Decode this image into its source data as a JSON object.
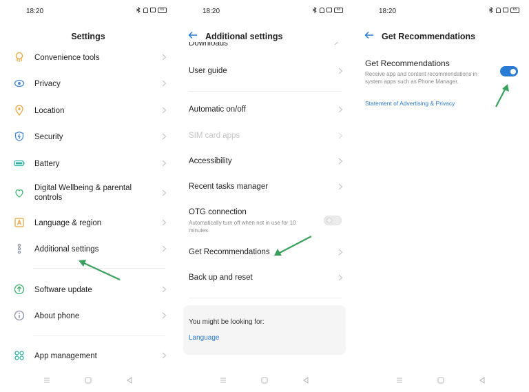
{
  "colors": {
    "accent": "#2a7bd4",
    "annotation_arrow": "#3aa15c",
    "text": "#222222",
    "muted": "#888888",
    "disabled": "#c4c4c4"
  },
  "status_bar": {
    "time": "18:20",
    "icons": [
      "bluetooth-icon",
      "bell-icon",
      "vibrate-icon",
      "battery-icon"
    ],
    "battery_level": "65"
  },
  "screen1": {
    "title": "Settings",
    "items": [
      {
        "label": "Convenience tools",
        "icon": "convenience-tools-icon"
      },
      {
        "label": "Privacy",
        "icon": "privacy-icon"
      },
      {
        "label": "Location",
        "icon": "location-icon"
      },
      {
        "label": "Security",
        "icon": "security-icon"
      },
      {
        "label": "Battery",
        "icon": "battery-icon"
      },
      {
        "label": "Digital Wellbeing & parental controls",
        "icon": "digital-wellbeing-icon"
      },
      {
        "label": "Language & region",
        "icon": "language-icon"
      },
      {
        "label": "Additional settings",
        "icon": "additional-settings-icon"
      },
      {
        "label": "Software update",
        "icon": "software-update-icon"
      },
      {
        "label": "About phone",
        "icon": "about-phone-icon"
      },
      {
        "label": "App management",
        "icon": "app-management-icon"
      }
    ]
  },
  "screen2": {
    "title": "Additional settings",
    "partial_item": "Downloads",
    "items": [
      {
        "label": "User guide",
        "enabled": true
      },
      {
        "label": "Automatic on/off",
        "enabled": true
      },
      {
        "label": "SIM card apps",
        "enabled": false
      },
      {
        "label": "Accessibility",
        "enabled": true
      },
      {
        "label": "Recent tasks manager",
        "enabled": true
      },
      {
        "label": "Get Recommendations",
        "enabled": true
      },
      {
        "label": "Back up and reset",
        "enabled": true
      }
    ],
    "otg": {
      "label": "OTG connection",
      "description": "Automatically turn off when not in use for 10 minutes.",
      "enabled": false
    },
    "suggestion": {
      "title": "You might be looking for:",
      "link": "Language"
    }
  },
  "screen3": {
    "title": "Get Recommendations",
    "setting_title": "Get Recommendations",
    "setting_description": "Receive app and content recommendations in system apps such as Phone Manager.",
    "enabled": true,
    "link": "Statement of Advertising & Privacy"
  },
  "nav_bar": {
    "icons": [
      "menu-icon",
      "home-icon",
      "back-icon"
    ]
  }
}
